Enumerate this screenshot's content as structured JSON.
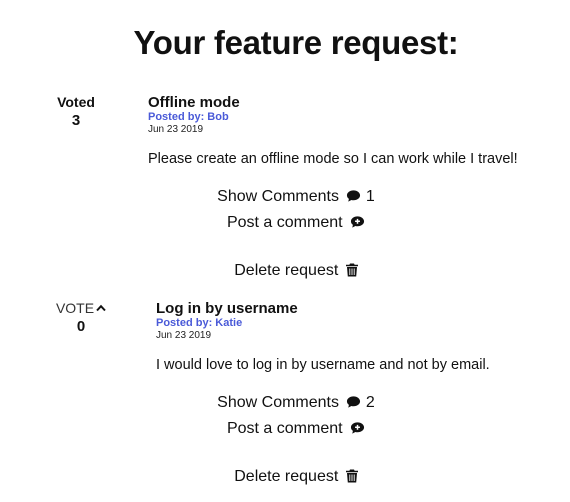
{
  "page": {
    "title": "Your feature request:"
  },
  "requests": [
    {
      "vote_label": "Voted",
      "vote_count": "3",
      "title": "Offline mode",
      "posted_by": "Posted by: Bob",
      "date": "Jun 23 2019",
      "body": "Please create an offline mode so I can work while I travel!",
      "show_comments_label": "Show Comments",
      "comment_count": "1",
      "post_comment_label": "Post a comment",
      "delete_label": "Delete request"
    },
    {
      "vote_label": "VOTE",
      "vote_count": "0",
      "title": "Log in by username",
      "posted_by": "Posted by: Katie",
      "date": "Jun 23 2019",
      "body": "I would love to log in by username and not by email.",
      "show_comments_label": "Show Comments",
      "comment_count": "2",
      "post_comment_label": "Post a comment",
      "delete_label": "Delete request"
    }
  ],
  "icons": {
    "comment": "comment-icon",
    "post_comment": "comment-plus-icon",
    "delete": "trash-icon",
    "vote": "caret-up-icon"
  },
  "colors": {
    "posted_by": "#4a5ad8",
    "text": "#111111"
  }
}
